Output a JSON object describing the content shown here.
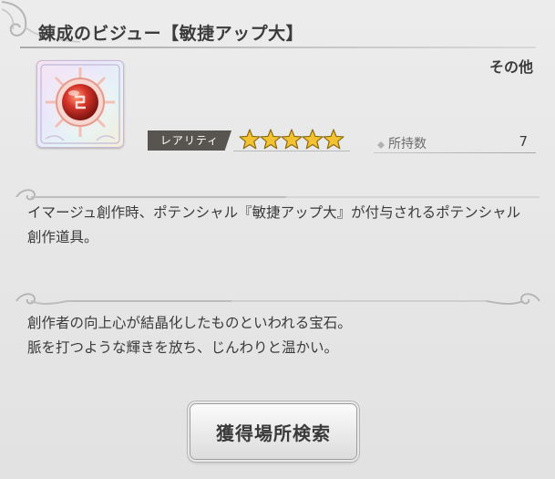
{
  "item": {
    "name": "錬成のビジュー【敏捷アップ大】",
    "category": "その他",
    "icon": "red-gem-icon",
    "rarity_label": "レアリティ",
    "rarity_stars": 5,
    "rarity_max": 5,
    "possession_label": "所持数",
    "possession_count": "7"
  },
  "description": "イマージュ創作時、ポテンシャル『敏捷アップ大』が付与されるポテンシャル創作道具。",
  "flavor_lines": [
    "創作者の向上心が結晶化したものといわれる宝石。",
    "脈を打つような輝きを放ち、じんわりと温かい。"
  ],
  "actions": {
    "search_label": "獲得場所検索"
  },
  "colors": {
    "background": "#e8e8e8",
    "text": "#3a3a3a",
    "rarity_tag": "#585450",
    "star_fill": "#f2c230",
    "gem": "#d6352a"
  }
}
